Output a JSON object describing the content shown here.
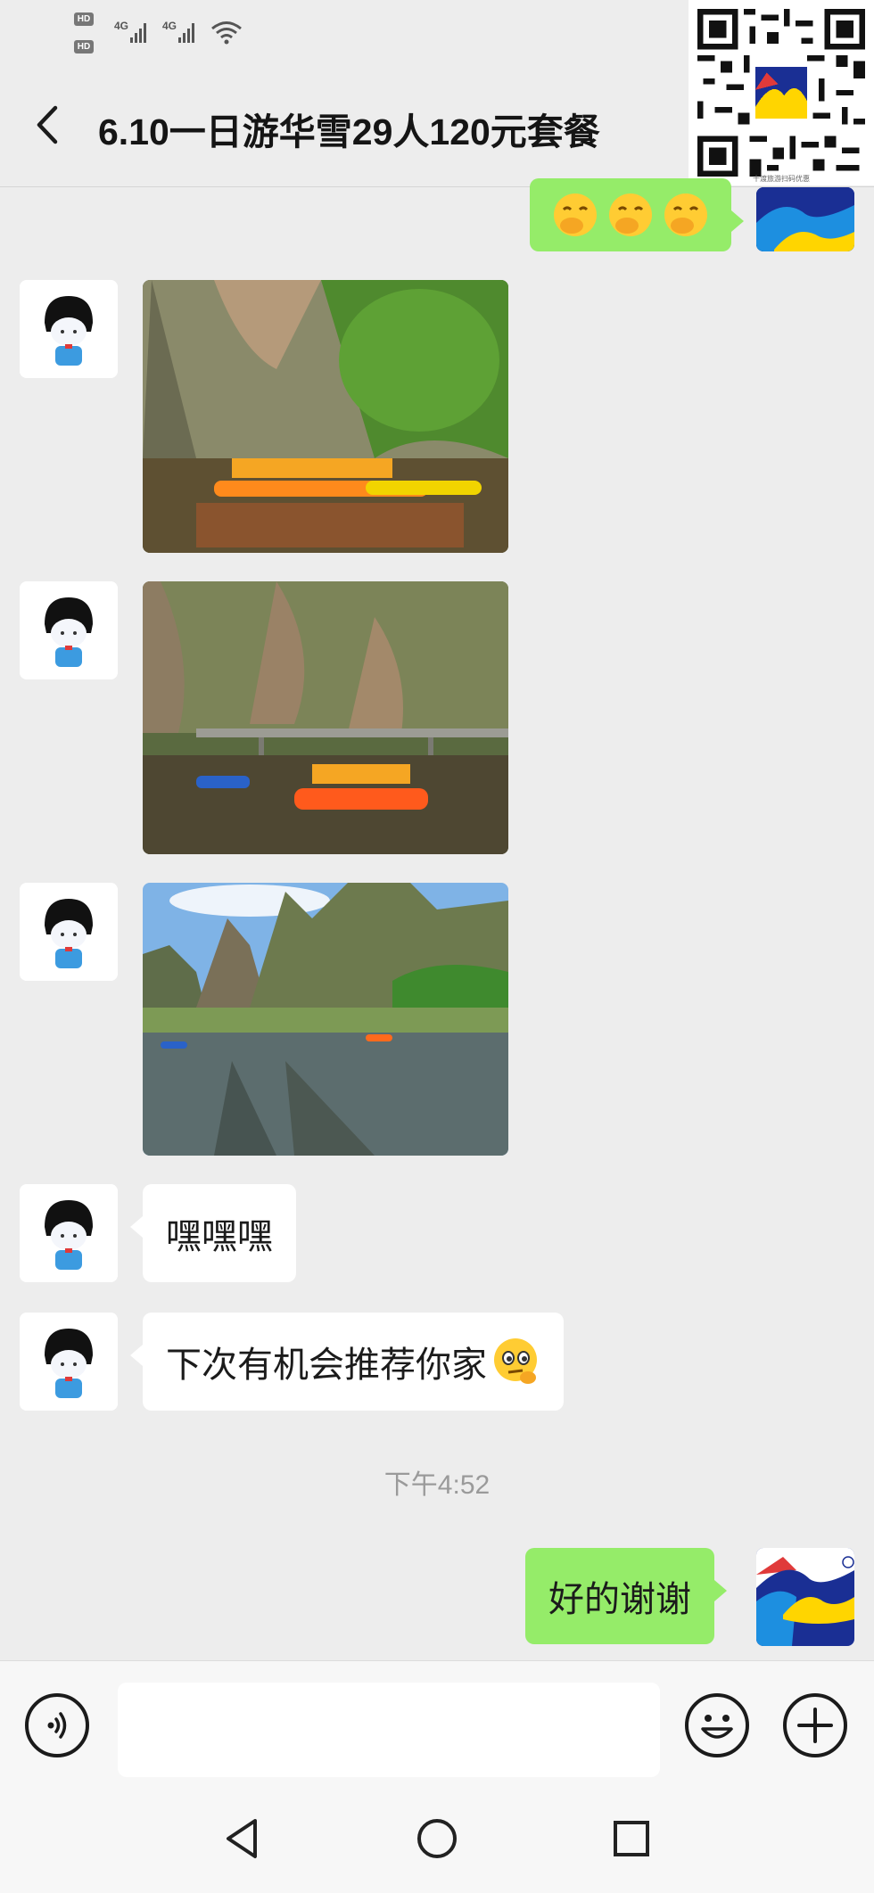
{
  "status_bar": {
    "hd1": "HD",
    "hd2": "HD",
    "net1": "4G",
    "net2": "4G"
  },
  "header": {
    "title": "6.10一日游华雪29人120元套餐"
  },
  "qr": {
    "caption": "十渡旅游扫码优惠"
  },
  "messages": [
    {
      "type": "emoji",
      "side": "right",
      "emoji": "face-with-hand-over-mouth",
      "count": 3
    },
    {
      "type": "image",
      "side": "left",
      "scene": "river-rafting-cliffs-green-trees"
    },
    {
      "type": "image",
      "side": "left",
      "scene": "river-rafting-bridge"
    },
    {
      "type": "image",
      "side": "left",
      "scene": "river-mountains-blue-sky"
    },
    {
      "type": "text",
      "side": "left",
      "text": "嘿嘿嘿"
    },
    {
      "type": "text",
      "side": "left",
      "text": "下次有机会推荐你家",
      "emoji": "thinking-face"
    },
    {
      "type": "time",
      "text": "下午4:52"
    },
    {
      "type": "text",
      "side": "right",
      "text": "好的谢谢"
    }
  ],
  "input_bar": {
    "voice_icon": "voice-icon",
    "emoji_icon": "smile-icon",
    "plus_icon": "plus-icon",
    "value": ""
  },
  "nav_bar": {
    "back": "triangle-back-icon",
    "home": "circle-home-icon",
    "recents": "square-recents-icon"
  },
  "colors": {
    "background": "#ededed",
    "sent_bubble": "#95ec69",
    "received_bubble": "#ffffff",
    "brand_blue": "#1a2f94",
    "brand_yellow": "#ffd500"
  }
}
